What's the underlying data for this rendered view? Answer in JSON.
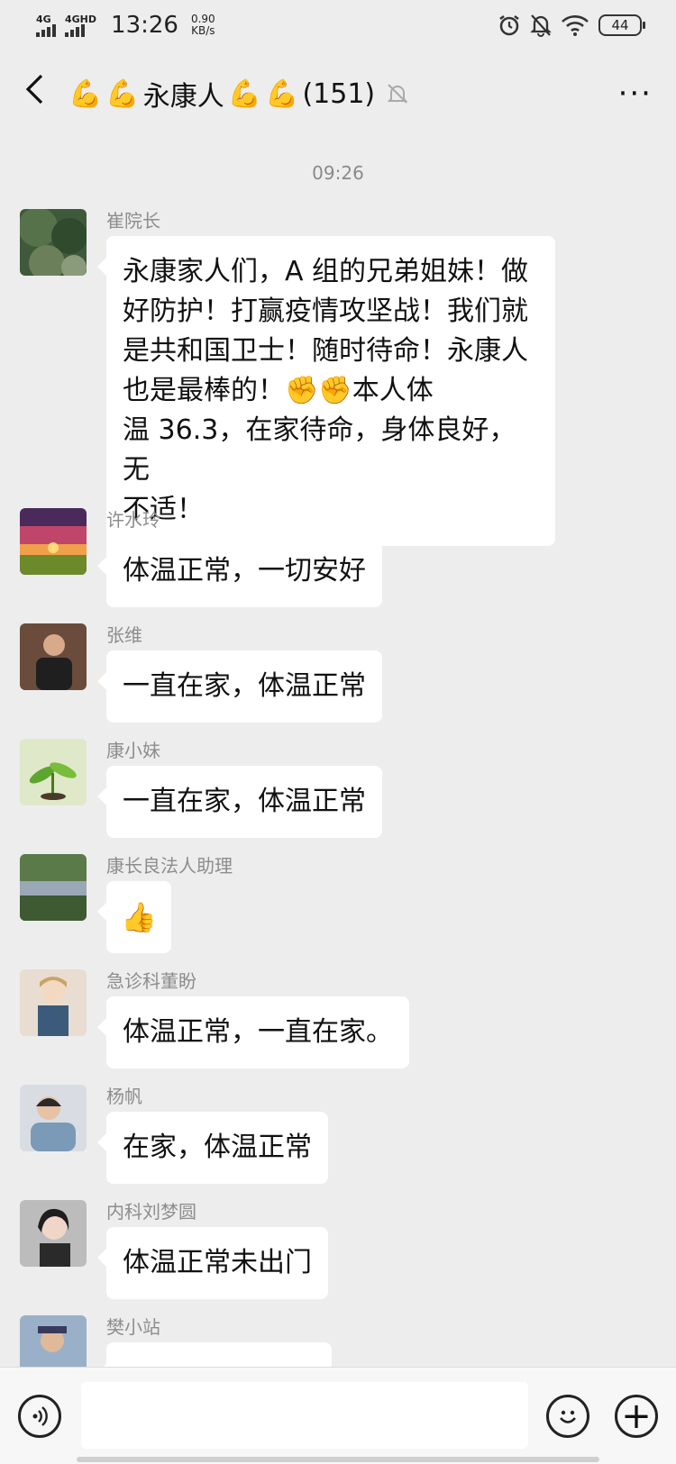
{
  "status_bar": {
    "signal1": "4G",
    "signal2": "4GHD",
    "time": "13:26",
    "net_speed": "0.90",
    "net_unit": "KB/s",
    "battery": "44"
  },
  "header": {
    "back_icon": "chevron-left-icon",
    "title_emoji": "💪",
    "title_text": "永康人",
    "member_count": "(151)",
    "mute_icon": "bell-off-icon",
    "more_label": "···"
  },
  "chat": {
    "timestamp": "09:26",
    "messages": [
      {
        "sender": "崔院长",
        "text_lines": [
          "永康家人们，A 组的兄弟姐妹！做",
          "好防护！打赢疫情攻坚战！我们就",
          "是共和国卫士！随时待命！永康人",
          "也是最棒的！✊✊本人体",
          "温 36.3，在家待命，身体良好，无",
          "不适！"
        ]
      },
      {
        "sender": "许水玲",
        "text": "体温正常，一切安好"
      },
      {
        "sender": "张维",
        "text": "一直在家，体温正常"
      },
      {
        "sender": "康小妹",
        "text": "一直在家，体温正常"
      },
      {
        "sender": "康长良法人助理",
        "text": "👍"
      },
      {
        "sender": "急诊科董盼",
        "text": "体温正常，一直在家。"
      },
      {
        "sender": "杨帆",
        "text": "在家，体温正常"
      },
      {
        "sender": "内科刘梦圆",
        "text": "体温正常未出门"
      },
      {
        "sender": "樊小站",
        "text": ""
      }
    ]
  },
  "input_bar": {
    "voice_icon": "voice-icon",
    "emoji_icon": "emoji-icon",
    "plus_icon": "plus-icon",
    "plus_label": "+"
  }
}
